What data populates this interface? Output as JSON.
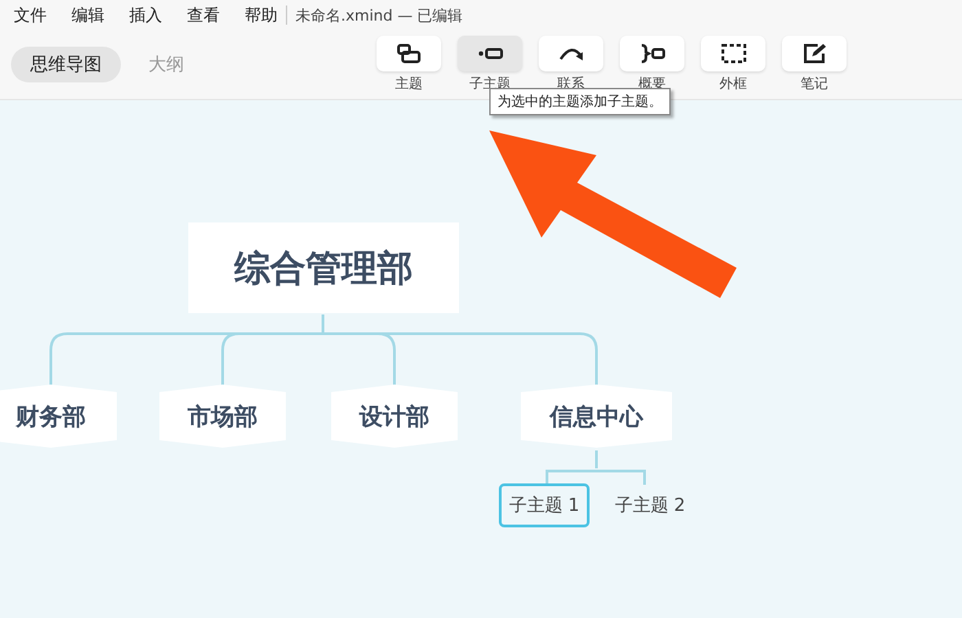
{
  "menu": [
    "文件",
    "编辑",
    "插入",
    "查看",
    "帮助"
  ],
  "document_title": "未命名.xmind — 已编辑",
  "view_tabs": [
    {
      "label": "思维导图",
      "selected": true
    },
    {
      "label": "大纲",
      "selected": false
    }
  ],
  "toolbar": [
    {
      "kind": "topic",
      "label": "主题",
      "selected": false
    },
    {
      "kind": "subtopic",
      "label": "子主题",
      "selected": true
    },
    {
      "kind": "relation",
      "label": "联系",
      "selected": false
    },
    {
      "kind": "summary",
      "label": "概要",
      "selected": false
    },
    {
      "kind": "boundary",
      "label": "外框",
      "selected": false
    },
    {
      "kind": "note",
      "label": "笔记",
      "selected": false
    }
  ],
  "tooltip": "为选中的主题添加子主题。",
  "mind_map": {
    "root": "综合管理部",
    "branches": [
      {
        "label": "财务部"
      },
      {
        "label": "市场部"
      },
      {
        "label": "设计部"
      },
      {
        "label": "信息中心",
        "children": [
          {
            "label": "子主题 1",
            "selected": true
          },
          {
            "label": "子主题 2",
            "selected": false
          }
        ]
      }
    ]
  }
}
